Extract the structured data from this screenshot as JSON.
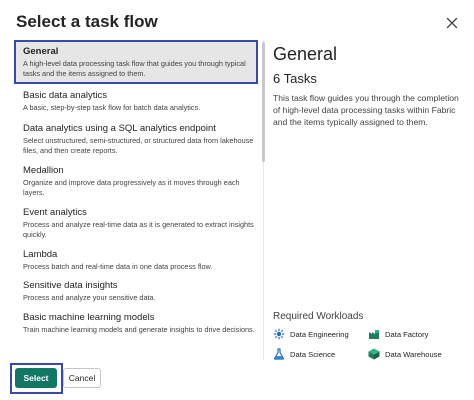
{
  "dialog": {
    "title": "Select a task flow",
    "close_icon": "close-icon"
  },
  "flows": [
    {
      "name": "General",
      "desc": "A high-level data processing task flow that guides you through typical tasks and the items assigned to them."
    },
    {
      "name": "Basic data analytics",
      "desc": "A basic, step-by-step task flow for batch data analytics."
    },
    {
      "name": "Data analytics using a SQL analytics endpoint",
      "desc": "Select unstructured, semi-structured, or structured data from lakehouse files, and then create reports."
    },
    {
      "name": "Medallion",
      "desc": "Organize and improve data progressively as it moves through each layers."
    },
    {
      "name": "Event analytics",
      "desc": "Process and analyze real-time data as it is generated to extract insights quickly."
    },
    {
      "name": "Lambda",
      "desc": "Process batch and real-time data in one data process flow."
    },
    {
      "name": "Sensitive data insights",
      "desc": "Process and analyze your sensitive data."
    },
    {
      "name": "Basic machine learning models",
      "desc": "Train machine learning models and generate insights to drive decisions."
    }
  ],
  "selected_index": 0,
  "detail": {
    "title": "General",
    "count": "6 Tasks",
    "desc": "This task flow guides you through the completion of high-level data processing tasks within Fabric and the items typically assigned to them."
  },
  "workloads": {
    "title": "Required Workloads",
    "items": [
      {
        "label": "Data Engineering",
        "icon": "data-engineering-icon",
        "color": "#1f6fbf"
      },
      {
        "label": "Data Factory",
        "icon": "data-factory-icon",
        "color": "#1a7f5a"
      },
      {
        "label": "Data Science",
        "icon": "data-science-icon",
        "color": "#1f6fbf"
      },
      {
        "label": "Data Warehouse",
        "icon": "data-warehouse-icon",
        "color": "#1a7f5a"
      }
    ]
  },
  "footer": {
    "select_label": "Select",
    "cancel_label": "Cancel"
  },
  "colors": {
    "primary": "#117865",
    "highlight_border": "#3949ab",
    "selected_bg": "#e6e6e6"
  }
}
